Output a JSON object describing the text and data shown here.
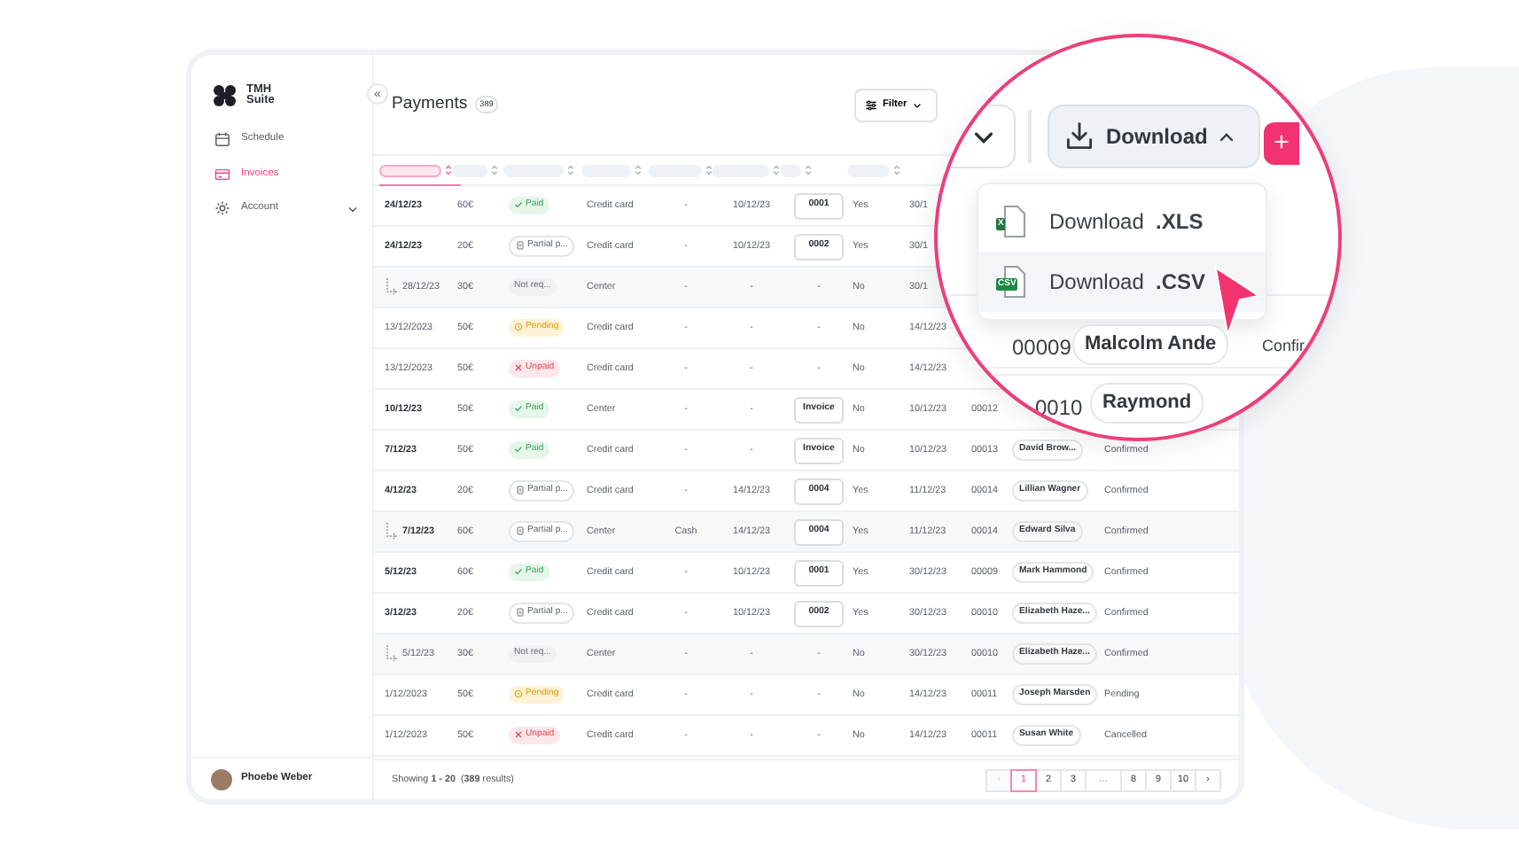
{
  "sidebar": {
    "logo": [
      "TMH",
      "Suite"
    ],
    "collapse": "«",
    "items": [
      {
        "kind": "calendar",
        "label": "Schedule",
        "selected": false,
        "expandable": false
      },
      {
        "kind": "card",
        "label": "Invoices",
        "selected": true,
        "expandable": false
      },
      {
        "kind": "gear",
        "label": "Account",
        "selected": false,
        "expandable": true
      }
    ],
    "user": {
      "name": "Phoebe Weber"
    }
  },
  "header": {
    "title": "Payments",
    "count": "389",
    "filter": "Filter"
  },
  "table": {
    "columns": [
      {
        "selected": true
      },
      {
        "selected": false
      },
      {
        "selected": false
      },
      {
        "selected": false
      },
      {
        "selected": false
      },
      {
        "selected": false
      },
      {
        "selected": false
      },
      {
        "selected": false
      }
    ],
    "rows": [
      {
        "kind": "parent",
        "bold": true,
        "cells": [
          {
            "kind": "date",
            "text": "24/12/23"
          },
          {
            "kind": "text",
            "text": "60€"
          },
          {
            "kind": "paid",
            "text": "Paid"
          },
          {
            "kind": "text",
            "text": "Credit card"
          },
          {
            "kind": "center",
            "text": "-"
          },
          {
            "kind": "center",
            "text": "10/12/23"
          },
          {
            "kind": "invoice",
            "text": "0001"
          },
          {
            "kind": "text",
            "text": "Yes"
          },
          {
            "kind": "text",
            "text": "30/1"
          }
        ]
      },
      {
        "kind": "parent",
        "bold": true,
        "cells": [
          {
            "kind": "date",
            "text": "24/12/23"
          },
          {
            "kind": "text",
            "text": "20€"
          },
          {
            "kind": "partial",
            "text": "Partial p..."
          },
          {
            "kind": "text",
            "text": "Credit card"
          },
          {
            "kind": "center",
            "text": "-"
          },
          {
            "kind": "center",
            "text": "10/12/23"
          },
          {
            "kind": "invoice",
            "text": "0002"
          },
          {
            "kind": "text",
            "text": "Yes"
          },
          {
            "kind": "text",
            "text": "30/1"
          }
        ]
      },
      {
        "kind": "child",
        "bold": false,
        "cells": [
          {
            "kind": "date",
            "text": "28/12/23"
          },
          {
            "kind": "text",
            "text": "30€"
          },
          {
            "kind": "notreq",
            "text": "Not req..."
          },
          {
            "kind": "text",
            "text": "Center"
          },
          {
            "kind": "center",
            "text": "-"
          },
          {
            "kind": "center",
            "text": "-"
          },
          {
            "kind": "center",
            "text": "-"
          },
          {
            "kind": "text",
            "text": "No"
          },
          {
            "kind": "text",
            "text": "30/1"
          }
        ]
      },
      {
        "kind": "parent",
        "bold": false,
        "cells": [
          {
            "kind": "date",
            "text": "13/12/2023"
          },
          {
            "kind": "text",
            "text": "50€"
          },
          {
            "kind": "pending",
            "text": "Pending"
          },
          {
            "kind": "text",
            "text": "Credit card"
          },
          {
            "kind": "center",
            "text": "-"
          },
          {
            "kind": "center",
            "text": "-"
          },
          {
            "kind": "center",
            "text": "-"
          },
          {
            "kind": "text",
            "text": "No"
          },
          {
            "kind": "text",
            "text": "14/12/23"
          }
        ]
      },
      {
        "kind": "parent",
        "bold": false,
        "cells": [
          {
            "kind": "date",
            "text": "13/12/2023"
          },
          {
            "kind": "text",
            "text": "50€"
          },
          {
            "kind": "unpaid",
            "text": "Unpaid"
          },
          {
            "kind": "text",
            "text": "Credit card"
          },
          {
            "kind": "center",
            "text": "-"
          },
          {
            "kind": "center",
            "text": "-"
          },
          {
            "kind": "center",
            "text": "-"
          },
          {
            "kind": "text",
            "text": "No"
          },
          {
            "kind": "text",
            "text": "14/12/23"
          }
        ]
      },
      {
        "kind": "parent",
        "bold": true,
        "cells": [
          {
            "kind": "date",
            "text": "10/12/23"
          },
          {
            "kind": "text",
            "text": "50€"
          },
          {
            "kind": "paid",
            "text": "Paid"
          },
          {
            "kind": "text",
            "text": "Center"
          },
          {
            "kind": "center",
            "text": "-"
          },
          {
            "kind": "center",
            "text": "-"
          },
          {
            "kind": "invoice",
            "text": "Invoice"
          },
          {
            "kind": "text",
            "text": "No"
          },
          {
            "kind": "text",
            "text": "10/12/23"
          },
          {
            "kind": "text",
            "text": "00012"
          }
        ]
      },
      {
        "kind": "parent",
        "bold": true,
        "cells": [
          {
            "kind": "date",
            "text": "7/12/23"
          },
          {
            "kind": "text",
            "text": "50€"
          },
          {
            "kind": "paid",
            "text": "Paid"
          },
          {
            "kind": "text",
            "text": "Credit card"
          },
          {
            "kind": "center",
            "text": "-"
          },
          {
            "kind": "center",
            "text": "-"
          },
          {
            "kind": "invoice",
            "text": "Invoice"
          },
          {
            "kind": "text",
            "text": "No"
          },
          {
            "kind": "text",
            "text": "10/12/23"
          },
          {
            "kind": "text",
            "text": "00013"
          },
          {
            "kind": "client",
            "text": "David Brow..."
          },
          {
            "kind": "text",
            "text": "Confirmed"
          }
        ]
      },
      {
        "kind": "parent",
        "bold": true,
        "cells": [
          {
            "kind": "date",
            "text": "4/12/23"
          },
          {
            "kind": "text",
            "text": "20€"
          },
          {
            "kind": "partial",
            "text": "Partial p..."
          },
          {
            "kind": "text",
            "text": "Credit card"
          },
          {
            "kind": "center",
            "text": "-"
          },
          {
            "kind": "center",
            "text": "14/12/23"
          },
          {
            "kind": "invoice",
            "text": "0004"
          },
          {
            "kind": "text",
            "text": "Yes"
          },
          {
            "kind": "text",
            "text": "11/12/23"
          },
          {
            "kind": "text",
            "text": "00014"
          },
          {
            "kind": "client",
            "text": "Lillian Wagner"
          },
          {
            "kind": "text",
            "text": "Confirmed"
          }
        ]
      },
      {
        "kind": "child",
        "bold": true,
        "cells": [
          {
            "kind": "date",
            "text": "7/12/23"
          },
          {
            "kind": "text",
            "text": "60€"
          },
          {
            "kind": "partial",
            "text": "Partial p..."
          },
          {
            "kind": "text",
            "text": "Center"
          },
          {
            "kind": "center",
            "text": "Cash"
          },
          {
            "kind": "center",
            "text": "14/12/23"
          },
          {
            "kind": "invoice",
            "text": "0004"
          },
          {
            "kind": "text",
            "text": "Yes"
          },
          {
            "kind": "text",
            "text": "11/12/23"
          },
          {
            "kind": "text",
            "text": "00014"
          },
          {
            "kind": "client",
            "text": "Edward Silva"
          },
          {
            "kind": "text",
            "text": "Confirmed"
          }
        ]
      },
      {
        "kind": "parent",
        "bold": true,
        "cells": [
          {
            "kind": "date",
            "text": "5/12/23"
          },
          {
            "kind": "text",
            "text": "60€"
          },
          {
            "kind": "paid",
            "text": "Paid"
          },
          {
            "kind": "text",
            "text": "Credit card"
          },
          {
            "kind": "center",
            "text": "-"
          },
          {
            "kind": "center",
            "text": "10/12/23"
          },
          {
            "kind": "invoice",
            "text": "0001"
          },
          {
            "kind": "text",
            "text": "Yes"
          },
          {
            "kind": "text",
            "text": "30/12/23"
          },
          {
            "kind": "text",
            "text": "00009"
          },
          {
            "kind": "client",
            "text": "Mark Hammond"
          },
          {
            "kind": "text",
            "text": "Confirmed"
          }
        ]
      },
      {
        "kind": "parent",
        "bold": true,
        "cells": [
          {
            "kind": "date",
            "text": "3/12/23"
          },
          {
            "kind": "text",
            "text": "20€"
          },
          {
            "kind": "partial",
            "text": "Partial p..."
          },
          {
            "kind": "text",
            "text": "Credit card"
          },
          {
            "kind": "center",
            "text": "-"
          },
          {
            "kind": "center",
            "text": "10/12/23"
          },
          {
            "kind": "invoice",
            "text": "0002"
          },
          {
            "kind": "text",
            "text": "Yes"
          },
          {
            "kind": "text",
            "text": "30/12/23"
          },
          {
            "kind": "text",
            "text": "00010"
          },
          {
            "kind": "client",
            "text": "Elizabeth Haze..."
          },
          {
            "kind": "text",
            "text": "Confirmed"
          }
        ]
      },
      {
        "kind": "child",
        "bold": false,
        "cells": [
          {
            "kind": "date",
            "text": "5/12/23"
          },
          {
            "kind": "text",
            "text": "30€"
          },
          {
            "kind": "notreq",
            "text": "Not req..."
          },
          {
            "kind": "text",
            "text": "Center"
          },
          {
            "kind": "center",
            "text": "-"
          },
          {
            "kind": "center",
            "text": "-"
          },
          {
            "kind": "center",
            "text": "-"
          },
          {
            "kind": "text",
            "text": "No"
          },
          {
            "kind": "text",
            "text": "30/12/23"
          },
          {
            "kind": "text",
            "text": "00010"
          },
          {
            "kind": "client",
            "text": "Elizabeth Haze..."
          },
          {
            "kind": "text",
            "text": "Confirmed"
          }
        ]
      },
      {
        "kind": "parent",
        "bold": false,
        "cells": [
          {
            "kind": "date",
            "text": "1/12/2023"
          },
          {
            "kind": "text",
            "text": "50€"
          },
          {
            "kind": "pending",
            "text": "Pending"
          },
          {
            "kind": "text",
            "text": "Credit card"
          },
          {
            "kind": "center",
            "text": "-"
          },
          {
            "kind": "center",
            "text": "-"
          },
          {
            "kind": "center",
            "text": "-"
          },
          {
            "kind": "text",
            "text": "No"
          },
          {
            "kind": "text",
            "text": "14/12/23"
          },
          {
            "kind": "text",
            "text": "00011"
          },
          {
            "kind": "client",
            "text": "Joseph Marsden"
          },
          {
            "kind": "text",
            "text": "Pending"
          }
        ]
      },
      {
        "kind": "parent",
        "bold": false,
        "cells": [
          {
            "kind": "date",
            "text": "1/12/2023"
          },
          {
            "kind": "text",
            "text": "50€"
          },
          {
            "kind": "unpaid",
            "text": "Unpaid"
          },
          {
            "kind": "text",
            "text": "Credit card"
          },
          {
            "kind": "center",
            "text": "-"
          },
          {
            "kind": "center",
            "text": "-"
          },
          {
            "kind": "center",
            "text": "-"
          },
          {
            "kind": "text",
            "text": "No"
          },
          {
            "kind": "text",
            "text": "14/12/23"
          },
          {
            "kind": "text",
            "text": "00011"
          },
          {
            "kind": "client",
            "text": "Susan White"
          },
          {
            "kind": "text",
            "text": "Cancelled"
          }
        ]
      }
    ]
  },
  "footer": {
    "summary": "Showing **1 - 20**  (**389** results)",
    "pages": [
      {
        "kind": "prev",
        "label": "‹",
        "selected": false,
        "disabled": true
      },
      {
        "kind": "page",
        "label": "1",
        "selected": true,
        "disabled": false
      },
      {
        "kind": "page",
        "label": "2",
        "selected": false,
        "disabled": false
      },
      {
        "kind": "page",
        "label": "3",
        "selected": false,
        "disabled": false
      },
      {
        "kind": "gap",
        "label": "…",
        "selected": false,
        "disabled": false
      },
      {
        "kind": "page",
        "label": "8",
        "selected": false,
        "disabled": false
      },
      {
        "kind": "page",
        "label": "9",
        "selected": false,
        "disabled": false
      },
      {
        "kind": "page",
        "label": "10",
        "selected": false,
        "disabled": false
      },
      {
        "kind": "next",
        "label": "›",
        "selected": false,
        "disabled": false
      }
    ]
  },
  "magnifier": {
    "filter_toggle": {
      "expanded": false
    },
    "download": {
      "label": "Download",
      "expanded": true
    },
    "add": "+",
    "menu": [
      {
        "kind": "xls",
        "badge": "X",
        "label": "Download  **.XLS**",
        "selected": false
      },
      {
        "kind": "csv",
        "badge": "CSV",
        "label": "Download  **.CSV**",
        "selected": true
      }
    ],
    "rows": [
      {
        "number": "00009",
        "client": "Malcolm Ande",
        "status": "Confir"
      },
      {
        "number": "0010",
        "client": "Raymond"
      }
    ]
  }
}
